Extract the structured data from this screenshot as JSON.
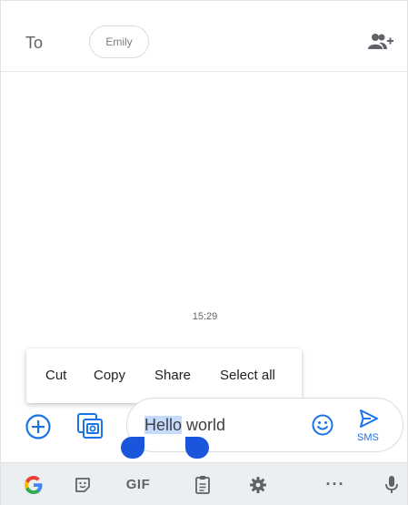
{
  "header": {
    "to_label": "To",
    "recipient_chip": "Emily",
    "add_contact_icon": "add-person-icon"
  },
  "conversation": {
    "timestamp": "15:29"
  },
  "context_menu": {
    "items": [
      "Cut",
      "Copy",
      "Share",
      "Select all"
    ]
  },
  "composer": {
    "selected_text": "Hello",
    "remaining_text": " world",
    "send_label": "SMS",
    "icons": [
      "add-circle-icon",
      "gallery-icon",
      "emoji-icon",
      "send-icon"
    ]
  },
  "keyboard_toolbar": {
    "gif_label": "GIF",
    "more_label": "···",
    "icons": [
      "google-icon",
      "sticker-icon",
      "clipboard-icon",
      "gear-icon",
      "more-icon",
      "mic-icon"
    ]
  },
  "colors": {
    "accent": "#1a73e8",
    "handle": "#1a56db",
    "selection": "#c6dafc",
    "keyboard_bg": "#eceff1"
  }
}
